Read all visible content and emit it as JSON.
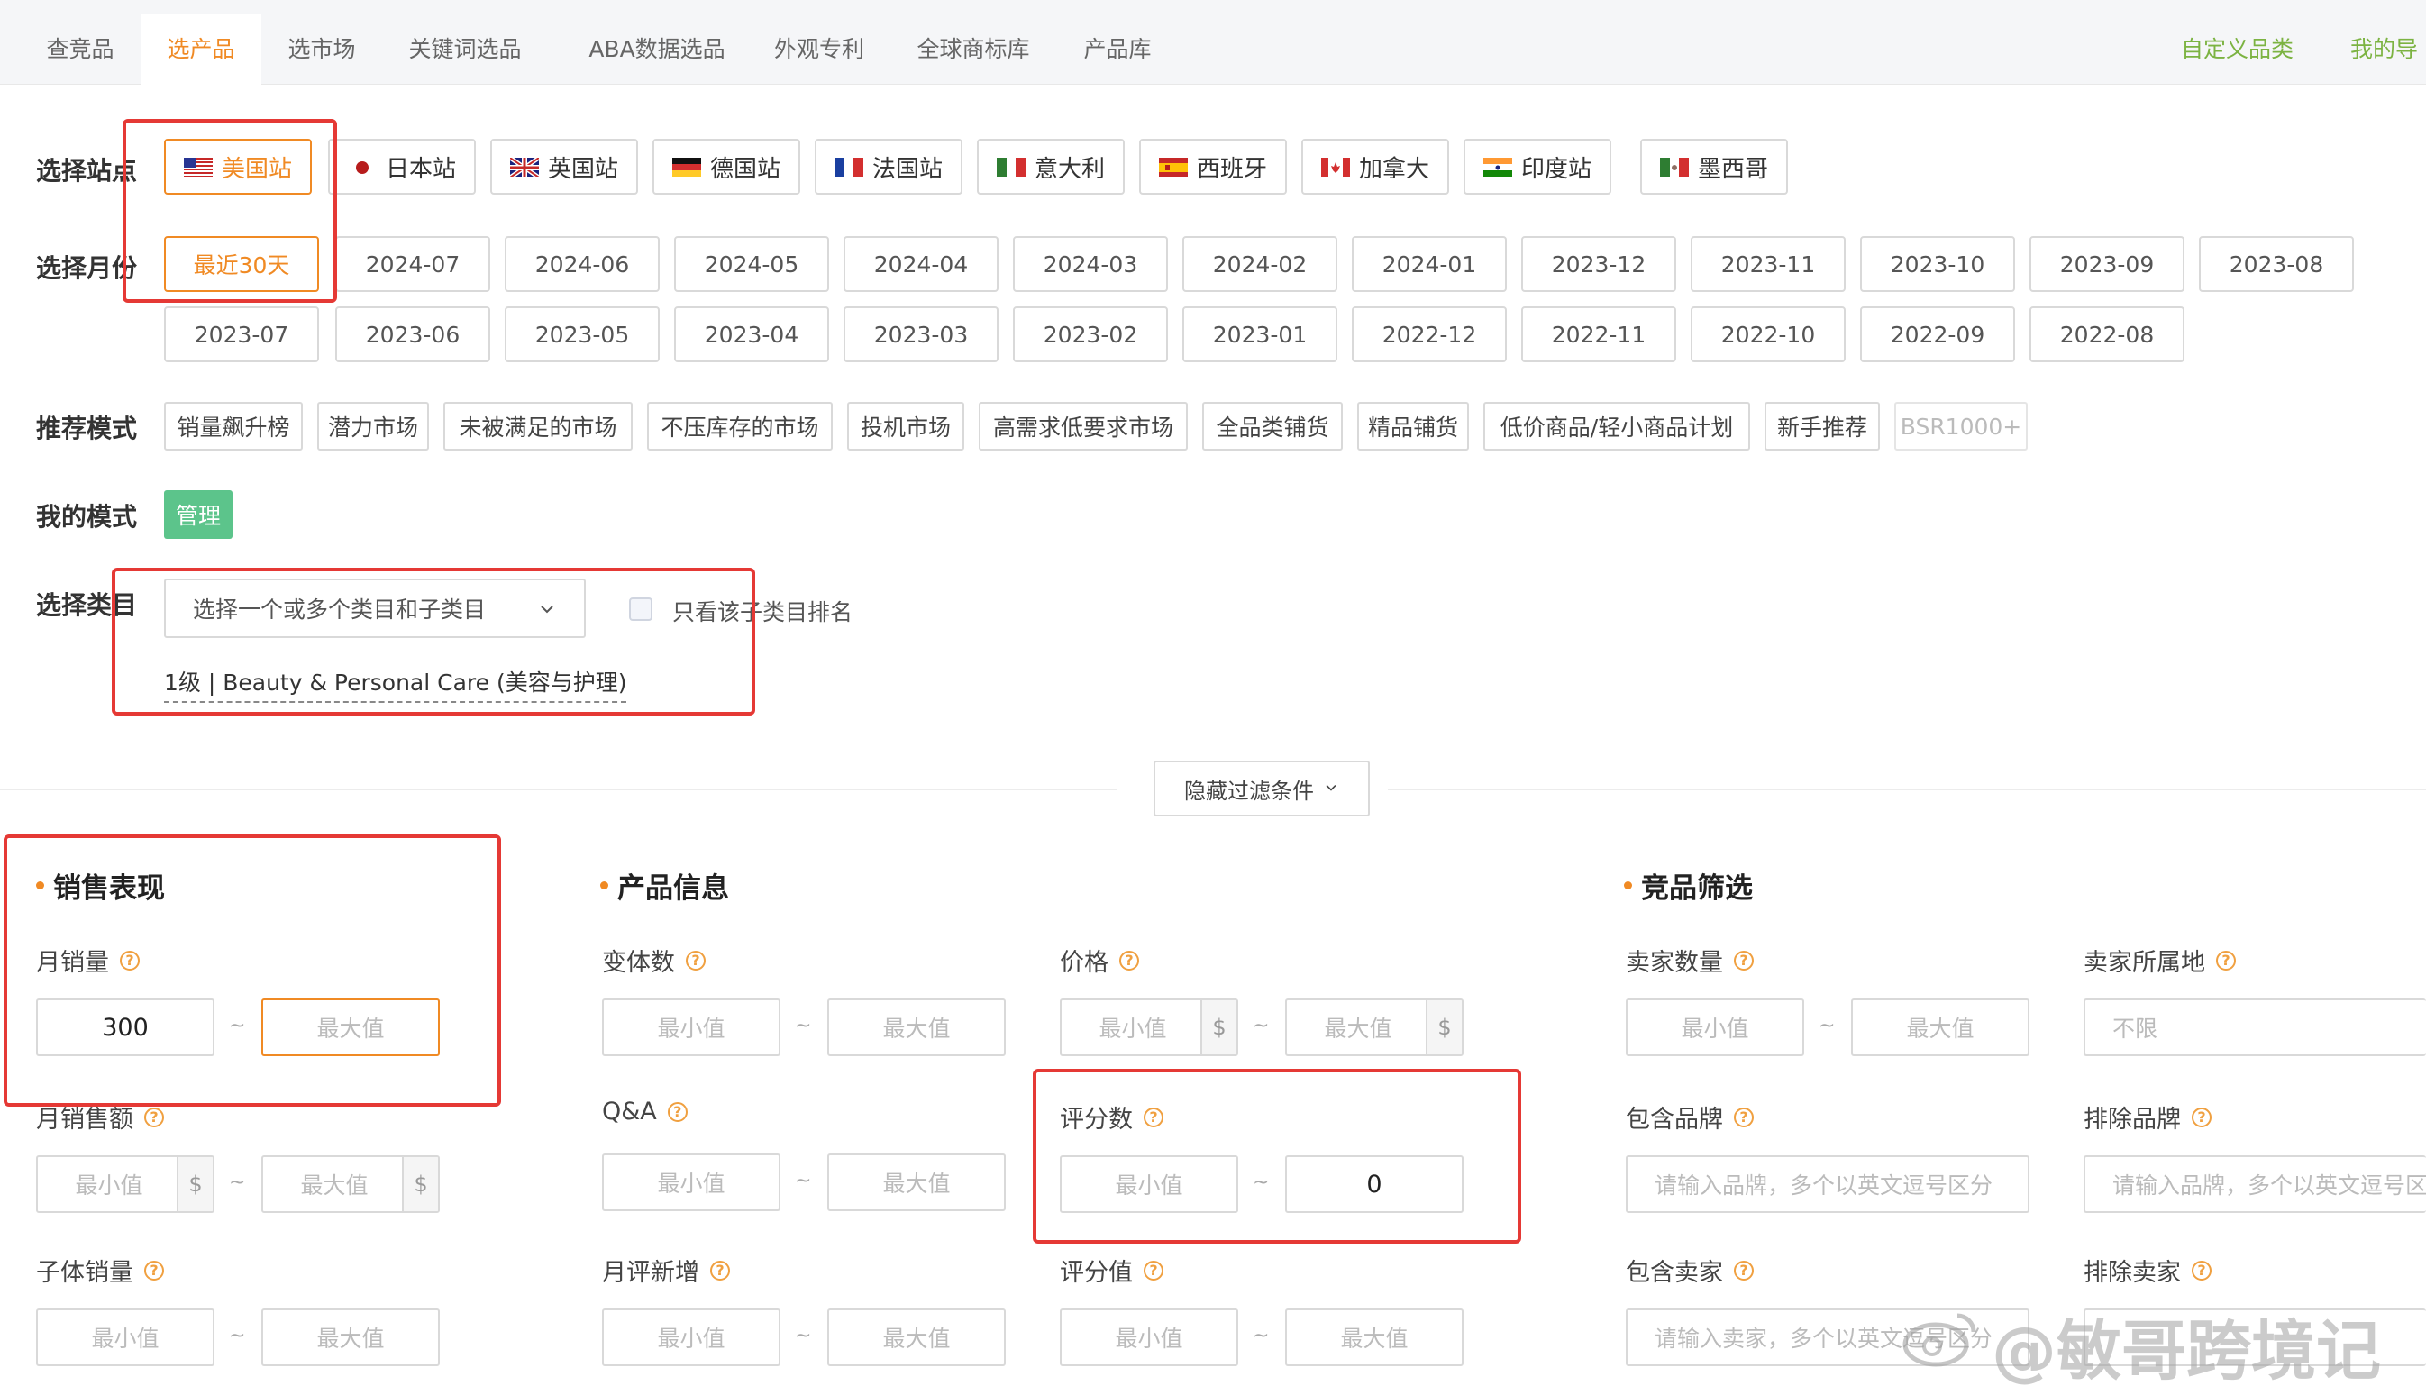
{
  "tabs": [
    {
      "label": "查竞品",
      "active": false
    },
    {
      "label": "选产品",
      "active": true
    },
    {
      "label": "选市场",
      "active": false
    },
    {
      "label": "关键词选品",
      "active": false
    },
    {
      "label": "ABA数据选品",
      "active": false
    },
    {
      "label": "外观专利",
      "active": false
    },
    {
      "label": "全球商标库",
      "active": false
    },
    {
      "label": "产品库",
      "active": false
    }
  ],
  "tabs_right": [
    "自定义品类",
    "我的导"
  ],
  "site_row": {
    "label": "选择站点",
    "sites": [
      {
        "label": "美国站",
        "flag": "us-flag-icon",
        "active": true
      },
      {
        "label": "日本站",
        "flag": "jp-flag-icon",
        "active": false
      },
      {
        "label": "英国站",
        "flag": "uk-flag-icon",
        "active": false
      },
      {
        "label": "德国站",
        "flag": "de-flag-icon",
        "active": false
      },
      {
        "label": "法国站",
        "flag": "fr-flag-icon",
        "active": false
      },
      {
        "label": "意大利",
        "flag": "it-flag-icon",
        "active": false
      },
      {
        "label": "西班牙",
        "flag": "es-flag-icon",
        "active": false
      },
      {
        "label": "加拿大",
        "flag": "ca-flag-icon",
        "active": false
      },
      {
        "label": "印度站",
        "flag": "in-flag-icon",
        "active": false
      },
      {
        "label": "墨西哥",
        "flag": "mx-flag-icon",
        "active": false
      }
    ]
  },
  "month_row": {
    "label": "选择月份",
    "months_row1": [
      "最近30天",
      "2024-07",
      "2024-06",
      "2024-05",
      "2024-04",
      "2024-03",
      "2024-02",
      "2024-01",
      "2023-12",
      "2023-11",
      "2023-10",
      "2023-09",
      "2023-08"
    ],
    "months_row2": [
      "2023-07",
      "2023-06",
      "2023-05",
      "2023-04",
      "2023-03",
      "2023-02",
      "2023-01",
      "2022-12",
      "2022-11",
      "2022-10",
      "2022-09",
      "2022-08"
    ],
    "active": "最近30天"
  },
  "mode_row": {
    "label": "推荐模式",
    "modes": [
      "销量飙升榜",
      "潜力市场",
      "未被满足的市场",
      "不压库存的市场",
      "投机市场",
      "高需求低要求市场",
      "全品类铺货",
      "精品铺货",
      "低价商品/轻小商品计划",
      "新手推荐",
      "BSR1000+"
    ]
  },
  "my_mode": {
    "label": "我的模式",
    "button": "管理"
  },
  "category": {
    "label": "选择类目",
    "select_placeholder": "选择一个或多个类目和子类目",
    "only_sub_label": "只看该子类目排名",
    "selected": "1级 | Beauty & Personal Care (美容与护理)"
  },
  "hide_filters": "隐藏过滤条件",
  "sections": {
    "sales": "销售表现",
    "product": "产品信息",
    "competitor": "竞品筛选"
  },
  "placeholders": {
    "min": "最小值",
    "max": "最大值",
    "unlimited": "不限",
    "currency": "$"
  },
  "tilde": "~",
  "fields": {
    "monthly_sales": {
      "label": "月销量",
      "min": "300",
      "max": ""
    },
    "monthly_revenue": {
      "label": "月销售额"
    },
    "child_sales": {
      "label": "子体销量"
    },
    "variants": {
      "label": "变体数"
    },
    "qa": {
      "label": "Q&A"
    },
    "monthly_new_reviews": {
      "label": "月评新增"
    },
    "price": {
      "label": "价格"
    },
    "review_count": {
      "label": "评分数",
      "min": "",
      "max": "0"
    },
    "rating": {
      "label": "评分值"
    },
    "seller_count": {
      "label": "卖家数量"
    },
    "seller_location": {
      "label": "卖家所属地"
    },
    "include_brand": {
      "label": "包含品牌",
      "placeholder": "请输入品牌，多个以英文逗号区分"
    },
    "exclude_brand": {
      "label": "排除品牌",
      "placeholder": "请输入品牌，多个以英文逗号区分"
    },
    "include_seller": {
      "label": "包含卖家",
      "placeholder": "请输入卖家，多个以英文逗号区分"
    },
    "exclude_seller": {
      "label": "排除卖家"
    }
  },
  "help_glyph": "?",
  "watermark": "@敏哥跨境记"
}
